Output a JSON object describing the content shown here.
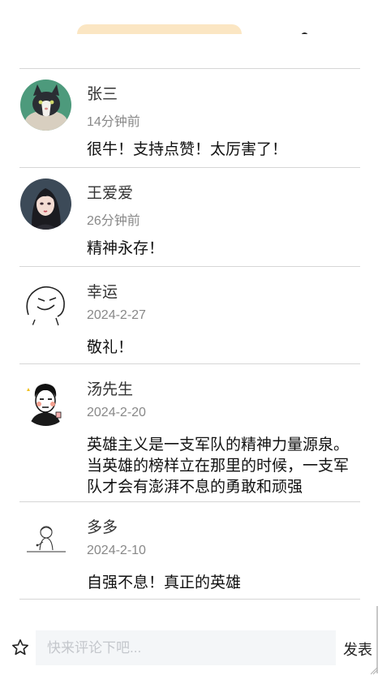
{
  "comments": [
    {
      "name": "张三",
      "time": "14分钟前",
      "text": "很牛！支持点赞！太厉害了！",
      "avatar": "cat-avatar"
    },
    {
      "name": "王爱爱",
      "time": "26分钟前",
      "text": "精神永存！",
      "avatar": "girl-avatar"
    },
    {
      "name": "幸运",
      "time": "2024-2-27",
      "text": "敬礼！",
      "avatar": "doodle-face-avatar"
    },
    {
      "name": "汤先生",
      "time": "2024-2-20",
      "text": "英雄主义是一支军队的精神力量源泉。当英雄的榜样立在那里的时候，一支军队才会有澎湃不息的勇敢和顽强",
      "avatar": "cartoon-man-avatar"
    },
    {
      "name": "多多",
      "time": "2024-2-10",
      "text": "自强不息！真正的英雄",
      "avatar": "sketch-figure-avatar"
    }
  ],
  "input": {
    "placeholder": "快来评论下吧..."
  },
  "send_label": "发表",
  "colors": {
    "divider": "#d6d6d6",
    "meta_text": "#888888",
    "input_bg": "#f4f6f8",
    "top_pill": "#fbe6c3"
  }
}
